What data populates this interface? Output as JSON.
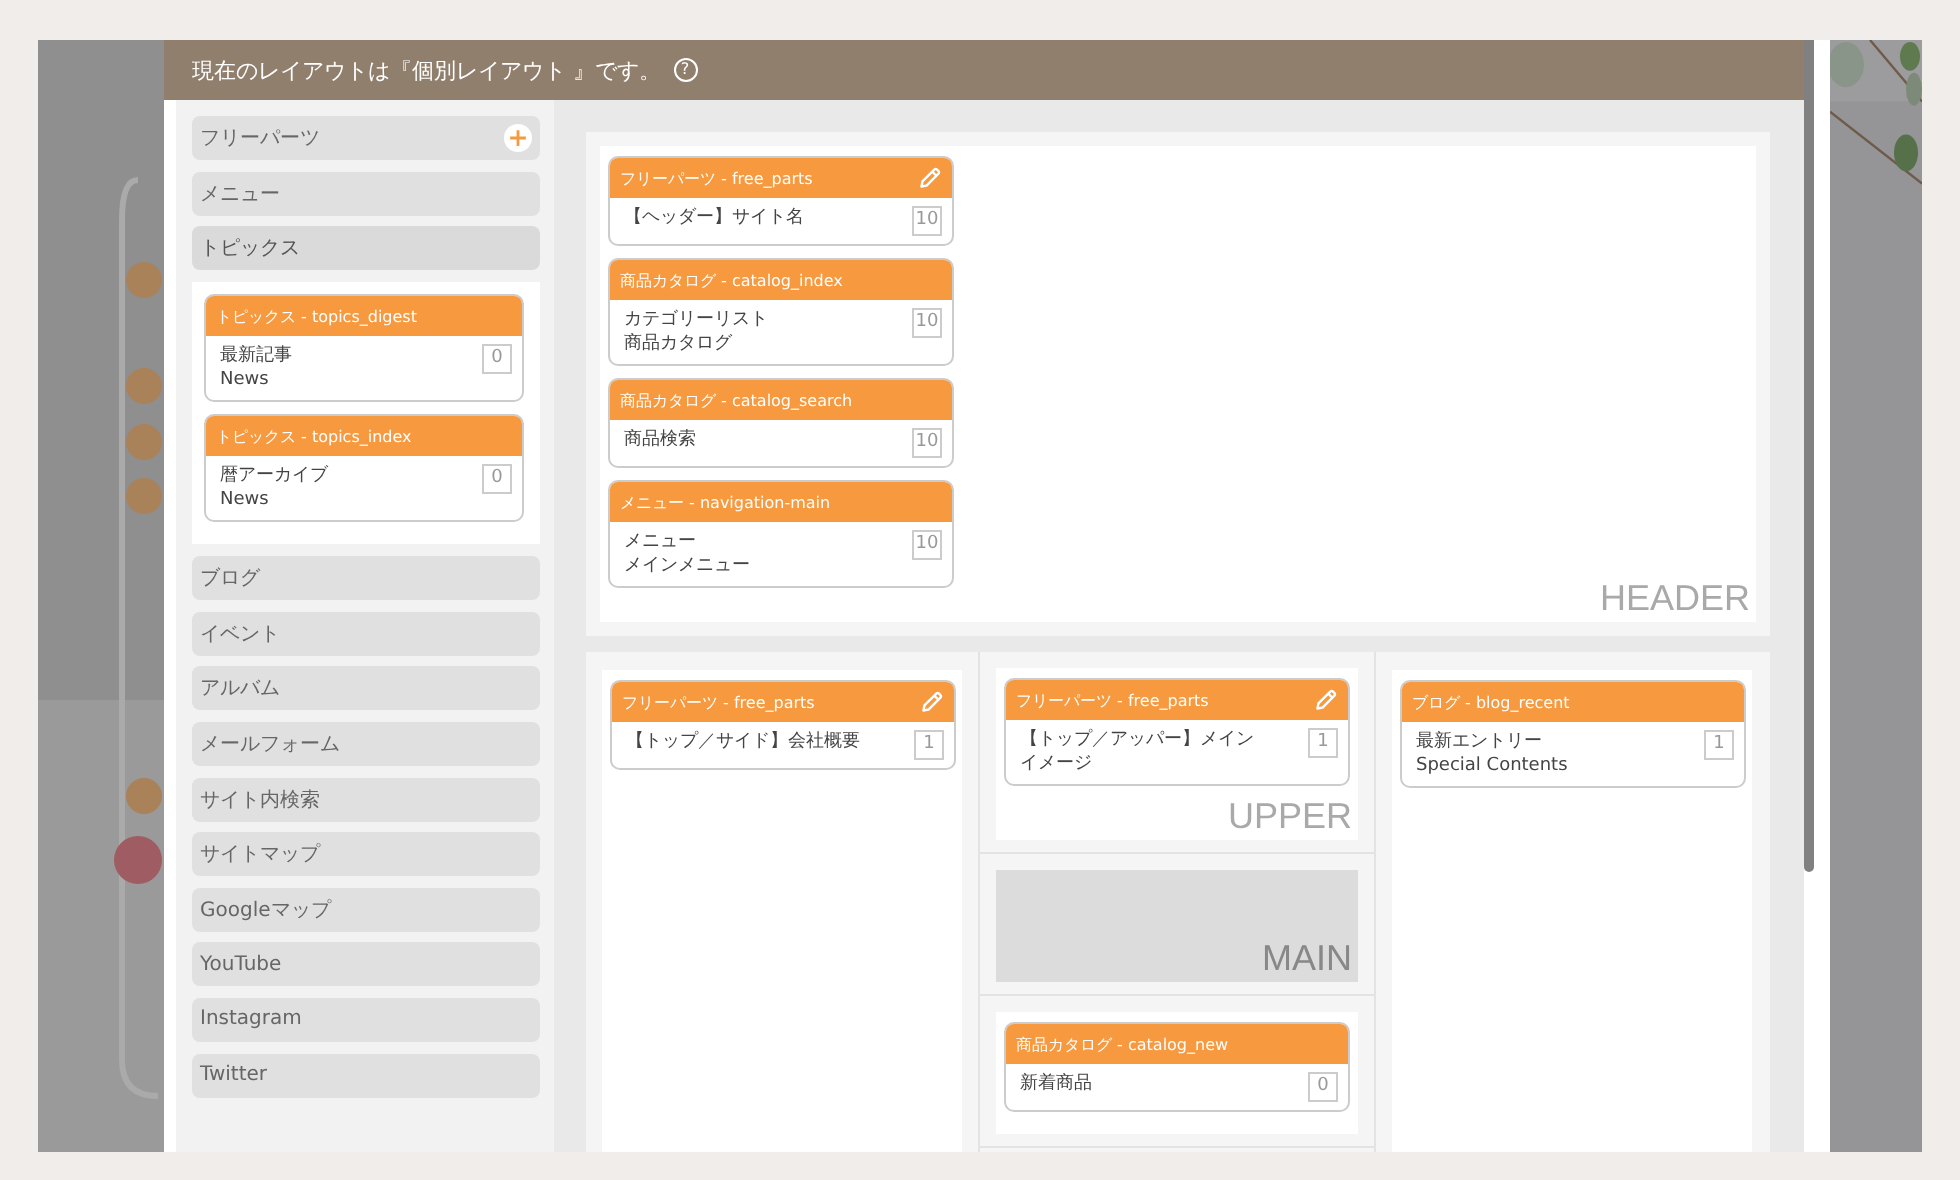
{
  "dialog": {
    "title": "現在のレイアウトは『個別レイアウト 』です。",
    "help": "?"
  },
  "sidebar": {
    "items": [
      {
        "label": "フリーパーツ",
        "add_button": true,
        "expanded": false
      },
      {
        "label": "メニュー",
        "add_button": false,
        "expanded": false
      },
      {
        "label": "トピックス",
        "add_button": false,
        "expanded": true,
        "cards": [
          {
            "title": "トピックス - topics_digest",
            "lines": [
              "最新記事",
              "News"
            ],
            "count": "0",
            "editable": false
          },
          {
            "title": "トピックス - topics_index",
            "lines": [
              "暦アーカイブ",
              "News"
            ],
            "count": "0",
            "editable": false
          }
        ]
      },
      {
        "label": "ブログ",
        "add_button": false,
        "expanded": false
      },
      {
        "label": "イベント",
        "add_button": false,
        "expanded": false
      },
      {
        "label": "アルバム",
        "add_button": false,
        "expanded": false
      },
      {
        "label": "メールフォーム",
        "add_button": false,
        "expanded": false
      },
      {
        "label": "サイト内検索",
        "add_button": false,
        "expanded": false
      },
      {
        "label": "サイトマップ",
        "add_button": false,
        "expanded": false
      },
      {
        "label": "Googleマップ",
        "add_button": false,
        "expanded": false
      },
      {
        "label": "YouTube",
        "add_button": false,
        "expanded": false
      },
      {
        "label": "Instagram",
        "add_button": false,
        "expanded": false
      },
      {
        "label": "Twitter",
        "add_button": false,
        "expanded": false
      }
    ]
  },
  "layout": {
    "header": {
      "label": "HEADER",
      "cards": [
        {
          "title": "フリーパーツ - free_parts",
          "lines": [
            "【ヘッダー】サイト名"
          ],
          "count": "10",
          "editable": true
        },
        {
          "title": "商品カタログ - catalog_index",
          "lines": [
            "カテゴリーリスト",
            "商品カタログ"
          ],
          "count": "10",
          "editable": false
        },
        {
          "title": "商品カタログ - catalog_search",
          "lines": [
            "商品検索"
          ],
          "count": "10",
          "editable": false
        },
        {
          "title": "メニュー - navigation-main",
          "lines": [
            "メニュー",
            "メインメニュー"
          ],
          "count": "10",
          "editable": false
        }
      ]
    },
    "left_column": {
      "cards": [
        {
          "title": "フリーパーツ - free_parts",
          "lines": [
            "【トップ／サイド】会社概要"
          ],
          "count": "1",
          "editable": true
        }
      ]
    },
    "center_column": [
      {
        "kind": "zone",
        "label": "UPPER",
        "cards": [
          {
            "title": "フリーパーツ - free_parts",
            "lines": [
              "【トップ／アッパー】メイン",
              "イメージ"
            ],
            "count": "1",
            "editable": true
          }
        ]
      },
      {
        "kind": "placeholder",
        "label": "MAIN"
      },
      {
        "kind": "zone",
        "cards": [
          {
            "title": "商品カタログ - catalog_new",
            "lines": [
              "新着商品"
            ],
            "count": "0",
            "editable": false
          }
        ]
      }
    ],
    "right_column": {
      "cards": [
        {
          "title": "ブログ - blog_recent",
          "lines": [
            "最新エントリー",
            "Special Contents"
          ],
          "count": "1",
          "editable": false
        }
      ]
    }
  }
}
